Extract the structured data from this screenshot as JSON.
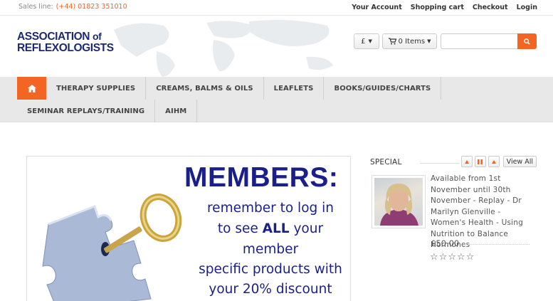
{
  "topbar": {
    "sales_label": "Sales line:",
    "sales_phone": "(+44) 01823 351010",
    "links": [
      "Your Account",
      "Shopping cart",
      "Checkout",
      "Login"
    ]
  },
  "header": {
    "logo_line1": "ASSOCIATION",
    "logo_line1_of": "of",
    "logo_line2": "REFLEXOLOGISTS",
    "currency_label": "£",
    "cart_label": "0 Items",
    "search_value": "",
    "search_icon": "search-icon",
    "cart_icon": "cart-icon"
  },
  "nav": {
    "home_icon": "home-icon",
    "row1": [
      "THERAPY SUPPLIES",
      "CREAMS, BALMS & OILS",
      "LEAFLETS",
      "BOOKS/GUIDES/CHARTS"
    ],
    "row2": [
      "SEMINAR REPLAYS/TRAINING",
      "AIHM"
    ]
  },
  "banner": {
    "title": "MEMBERS:",
    "line1": "remember to log in",
    "line2_pre": "to see",
    "line2_bold": "ALL",
    "line2_post": "your",
    "line3": "member",
    "line4": "specific products with",
    "line5": "your 20% discount"
  },
  "special": {
    "title": "SPECIAL",
    "view_all": "View All",
    "product_description": "Available from 1st November until 30th November - Replay - Dr Marilyn Glenville - Women's Health - Using Nutrition to Balance Hormones",
    "price": "£50.00",
    "rating": 0,
    "rating_max": 5
  },
  "colors": {
    "accent": "#f26522",
    "brand_navy": "#1d2a73",
    "banner_text": "#1a1f8a",
    "nav_bg": "#e8e8e8"
  }
}
